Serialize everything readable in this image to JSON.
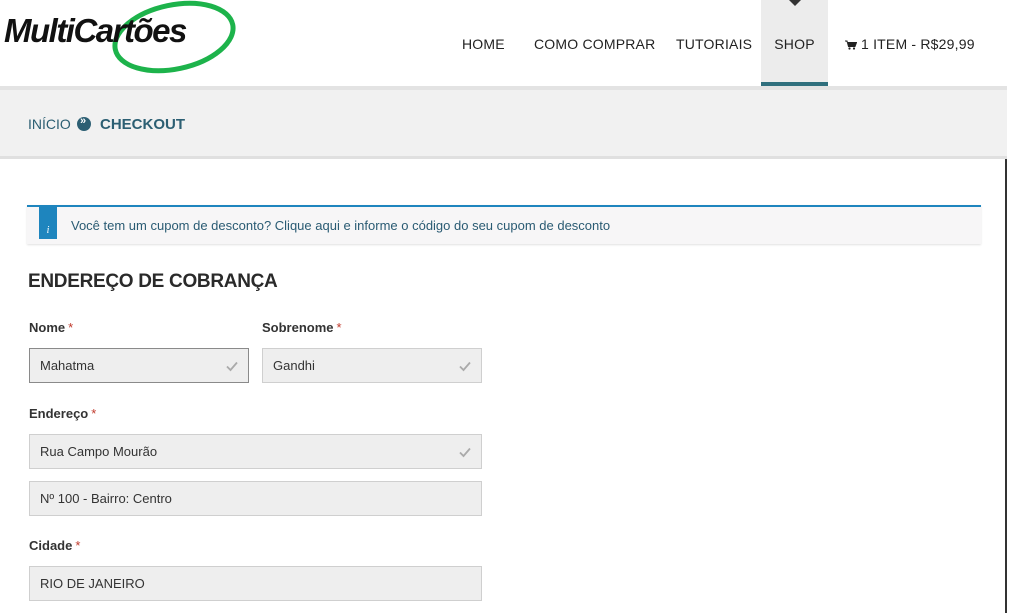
{
  "brand": {
    "name": "MultiCartões"
  },
  "nav": {
    "items": [
      {
        "label": "HOME"
      },
      {
        "label": "COMO COMPRAR"
      },
      {
        "label": "TUTORIAIS"
      },
      {
        "label": "SHOP"
      }
    ],
    "cart_label": "1 ITEM - R$29,99"
  },
  "breadcrumb": {
    "home": "INÍCIO",
    "current": "CHECKOUT"
  },
  "notice": {
    "icon_text": "i",
    "text": "Você tem um cupom de desconto? Clique aqui e informe o código do seu cupom de desconto"
  },
  "billing": {
    "title": "ENDEREÇO DE COBRANÇA",
    "required_mark": "*",
    "first_name": {
      "label": "Nome",
      "value": "Mahatma"
    },
    "last_name": {
      "label": "Sobrenome",
      "value": "Gandhi"
    },
    "address": {
      "label": "Endereço",
      "line1": "Rua Campo Mourão",
      "line2": "Nº 100 - Bairro: Centro"
    },
    "city": {
      "label": "Cidade",
      "value": "RIO DE JANEIRO"
    }
  },
  "colors": {
    "accent": "#2c5f73",
    "notice_blue": "#1e85be",
    "logo_green": "#1db34b",
    "required": "#c0392b"
  }
}
